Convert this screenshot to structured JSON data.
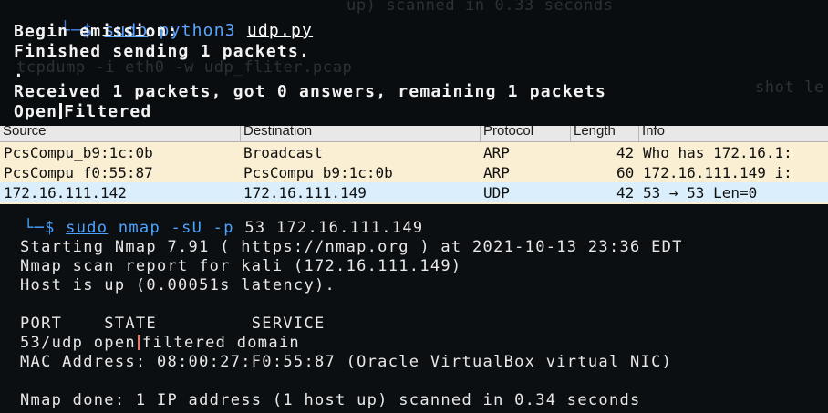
{
  "top_terminal": {
    "ghost_lines": [
      "up) scanned in 0.33 seconds",
      "tcpdump -i eth0 -w udp_fliter.pcap",
      "shot le"
    ],
    "prompt": {
      "corner": "└─",
      "symbol": "$",
      "sudo": "sudo",
      "program": "python3",
      "file": "udp.py"
    },
    "lines": [
      "Begin emission:",
      "Finished sending 1 packets.",
      ".",
      "Received 1 packets, got 0 answers, remaining 1 packets"
    ],
    "state_left": "Open",
    "state_right": "Filtered"
  },
  "packet_list": {
    "columns": [
      "Source",
      "Destination",
      "Protocol",
      "Length",
      "Info"
    ],
    "rows": [
      {
        "source": "PcsCompu_b9:1c:0b",
        "destination": "Broadcast",
        "protocol": "ARP",
        "length": "42",
        "info": "Who has 172.16.1:",
        "highlight": "arp"
      },
      {
        "source": "PcsCompu_f0:55:87",
        "destination": "PcsCompu_b9:1c:0b",
        "protocol": "ARP",
        "length": "60",
        "info": "172.16.111.149 i:",
        "highlight": "arp"
      },
      {
        "source": "172.16.111.142",
        "destination": "172.16.111.149",
        "protocol": "UDP",
        "length": "42",
        "info": "53 → 53 Len=0",
        "highlight": "udp"
      }
    ],
    "colors": {
      "arp": "#fbefd3",
      "udp": "#dbeefb"
    }
  },
  "nmap_terminal": {
    "prompt": {
      "corner": "└─",
      "symbol": "$",
      "sudo": "sudo",
      "program": "nmap",
      "flags": "-sU -p",
      "args": "53 172.16.111.149"
    },
    "lines": [
      "Starting Nmap 7.91 ( https://nmap.org ) at 2021-10-13 23:36 EDT",
      "Nmap scan report for kali (172.16.111.149)",
      "Host is up (0.00051s latency).",
      "",
      "PORT    STATE         SERVICE"
    ],
    "port_row": {
      "port": "53/udp",
      "state_left": "open",
      "state_right": "filtered",
      "service": "domain"
    },
    "mac_line": "MAC Address: 08:00:27:F0:55:87 (Oracle VirtualBox virtual NIC)",
    "done_line": "Nmap done: 1 IP address (1 host up) scanned in 0.34 seconds"
  }
}
